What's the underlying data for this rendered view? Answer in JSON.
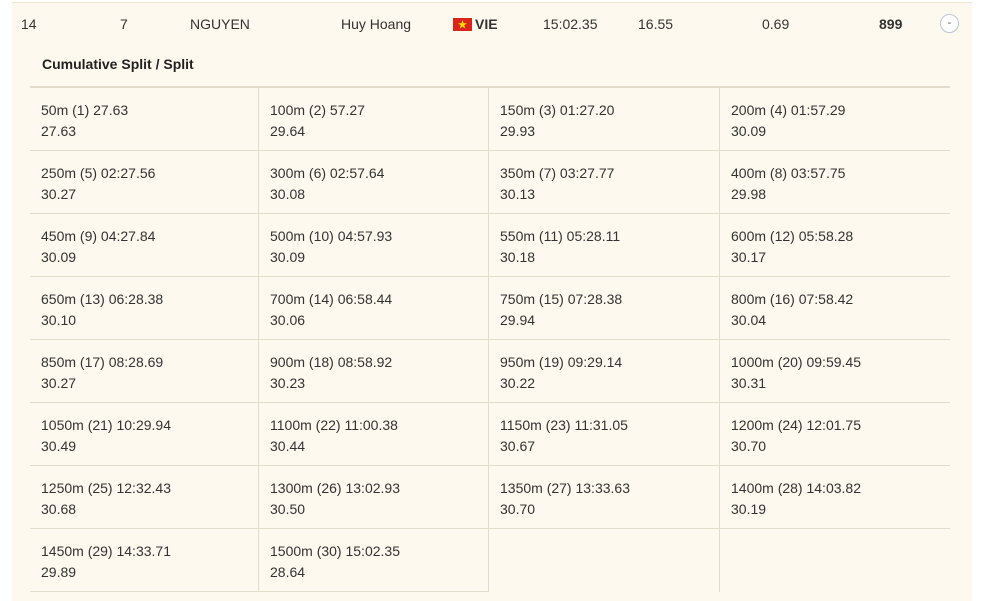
{
  "result_row": {
    "rank": "14",
    "lane": "7",
    "last_name": "NGUYEN",
    "first_name": "Huy Hoang",
    "nation": "VIE",
    "time": "15:02.35",
    "behind": "16.55",
    "reaction_time": "0.69",
    "points": "899",
    "toggle_label": "-"
  },
  "splits_panel": {
    "title": "Cumulative Split / Split",
    "splits": [
      {
        "cumulative": "50m (1) 27.63",
        "split": "27.63"
      },
      {
        "cumulative": "100m (2) 57.27",
        "split": "29.64"
      },
      {
        "cumulative": "150m (3) 01:27.20",
        "split": "29.93"
      },
      {
        "cumulative": "200m (4) 01:57.29",
        "split": "30.09"
      },
      {
        "cumulative": "250m (5) 02:27.56",
        "split": "30.27"
      },
      {
        "cumulative": "300m (6) 02:57.64",
        "split": "30.08"
      },
      {
        "cumulative": "350m (7) 03:27.77",
        "split": "30.13"
      },
      {
        "cumulative": "400m (8) 03:57.75",
        "split": "29.98"
      },
      {
        "cumulative": "450m (9) 04:27.84",
        "split": "30.09"
      },
      {
        "cumulative": "500m (10) 04:57.93",
        "split": "30.09"
      },
      {
        "cumulative": "550m (11) 05:28.11",
        "split": "30.18"
      },
      {
        "cumulative": "600m (12) 05:58.28",
        "split": "30.17"
      },
      {
        "cumulative": "650m (13) 06:28.38",
        "split": "30.10"
      },
      {
        "cumulative": "700m (14) 06:58.44",
        "split": "30.06"
      },
      {
        "cumulative": "750m (15) 07:28.38",
        "split": "29.94"
      },
      {
        "cumulative": "800m (16) 07:58.42",
        "split": "30.04"
      },
      {
        "cumulative": "850m (17) 08:28.69",
        "split": "30.27"
      },
      {
        "cumulative": "900m (18) 08:58.92",
        "split": "30.23"
      },
      {
        "cumulative": "950m (19) 09:29.14",
        "split": "30.22"
      },
      {
        "cumulative": "1000m (20) 09:59.45",
        "split": "30.31"
      },
      {
        "cumulative": "1050m (21) 10:29.94",
        "split": "30.49"
      },
      {
        "cumulative": "1100m (22) 11:00.38",
        "split": "30.44"
      },
      {
        "cumulative": "1150m (23) 11:31.05",
        "split": "30.67"
      },
      {
        "cumulative": "1200m (24) 12:01.75",
        "split": "30.70"
      },
      {
        "cumulative": "1250m (25) 12:32.43",
        "split": "30.68"
      },
      {
        "cumulative": "1300m (26) 13:02.93",
        "split": "30.50"
      },
      {
        "cumulative": "1350m (27) 13:33.63",
        "split": "30.70"
      },
      {
        "cumulative": "1400m (28) 14:03.82",
        "split": "30.19"
      },
      {
        "cumulative": "1450m (29) 14:33.71",
        "split": "29.89"
      },
      {
        "cumulative": "1500m (30) 15:02.35",
        "split": "28.64"
      }
    ]
  },
  "icons": {
    "flag": "vietnam-flag-icon",
    "toggle": "collapse-icon"
  },
  "colors": {
    "row_background": "#fdf9ee",
    "border": "#e2dccb",
    "flag_red": "#da251d",
    "flag_star": "#ffdd00"
  }
}
